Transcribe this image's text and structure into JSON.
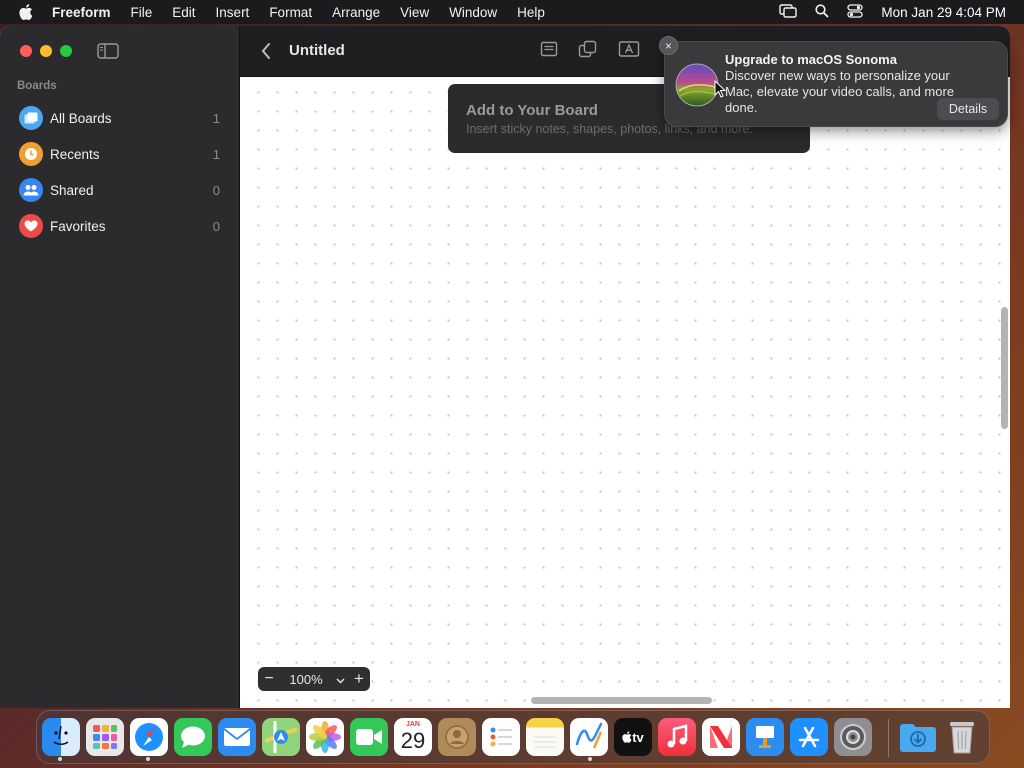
{
  "menubar": {
    "app_name": "Freeform",
    "items": [
      "File",
      "Edit",
      "Insert",
      "Format",
      "Arrange",
      "View",
      "Window",
      "Help"
    ],
    "clock": "Mon Jan 29  4:04 PM"
  },
  "sidebar": {
    "heading": "Boards",
    "items": [
      {
        "label": "All Boards",
        "count": "1",
        "icon": "boards-icon",
        "color": "#4aa8f0"
      },
      {
        "label": "Recents",
        "count": "1",
        "icon": "clock-icon",
        "color": "#f0a030"
      },
      {
        "label": "Shared",
        "count": "0",
        "icon": "people-icon",
        "color": "#3a86f0"
      },
      {
        "label": "Favorites",
        "count": "0",
        "icon": "heart-icon",
        "color": "#ef4a4a"
      }
    ]
  },
  "toolbar": {
    "title": "Untitled",
    "tools": [
      "sticky-note-icon",
      "shapes-icon",
      "text-box-icon"
    ]
  },
  "canvas": {
    "tip_title": "Add to Your Board",
    "tip_subtitle": "Insert sticky notes, shapes, photos, links, and more.",
    "zoom": {
      "minus": "−",
      "value": "100%",
      "plus": "+"
    }
  },
  "notification": {
    "title": "Upgrade to macOS Sonoma",
    "body": "Discover new ways to personalize your Mac, elevate your video calls, and more done.",
    "button": "Details",
    "close": "×"
  },
  "dock": {
    "apps": [
      "Finder",
      "Launchpad",
      "Safari",
      "Messages",
      "Mail",
      "Maps",
      "Photos",
      "FaceTime",
      "Calendar",
      "Contacts",
      "Reminders",
      "Notes",
      "Freeform",
      "TV",
      "Music",
      "News",
      "Keynote",
      "App Store",
      "System Settings",
      "Downloads",
      "Trash"
    ],
    "calendar_month": "JAN",
    "calendar_day": "29",
    "tv_label": "tv"
  },
  "colors": {
    "close": "#ff5f57",
    "minimize": "#febc2e",
    "zoom": "#28c840",
    "sidebar_bg": "#2b2b2e",
    "toolbar_bg": "#1f1f21"
  }
}
